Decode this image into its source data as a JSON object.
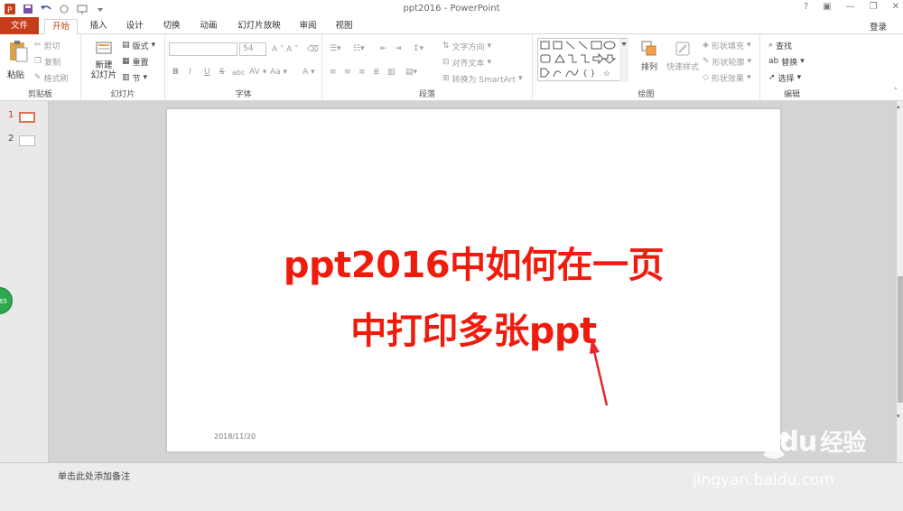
{
  "window": {
    "title": "ppt2016 - PowerPoint",
    "controls": [
      "?",
      "▣",
      "—",
      "❐",
      "✕"
    ]
  },
  "quick_access": [
    "ppt-icon",
    "save-icon",
    "undo-icon",
    "redo-icon",
    "present-icon",
    "customize-icon"
  ],
  "tabs": [
    {
      "label": "文件"
    },
    {
      "label": "开始"
    },
    {
      "label": "插入"
    },
    {
      "label": "设计"
    },
    {
      "label": "切换"
    },
    {
      "label": "动画"
    },
    {
      "label": "幻灯片放映"
    },
    {
      "label": "审阅"
    },
    {
      "label": "视图"
    }
  ],
  "account": {
    "login": "登录"
  },
  "ribbon": {
    "clipboard": {
      "label": "剪贴板",
      "paste": "粘贴",
      "cut": "剪切",
      "copy": "复制",
      "format_painter": "格式刷"
    },
    "slides": {
      "label": "幻灯片",
      "new_slide_1": "新建",
      "new_slide_2": "幻灯片",
      "layout": "版式",
      "reset": "重置",
      "section": "节"
    },
    "font": {
      "label": "字体",
      "font_name": "",
      "font_size": "54",
      "bold": "B",
      "italic": "I",
      "underline": "U",
      "strike": "S",
      "shadow": "abc",
      "spacing": "AV",
      "case": "Aa",
      "color": "A",
      "grow": "A",
      "shrink": "A"
    },
    "paragraph": {
      "label": "段落",
      "text_direction": "文字方向",
      "align_text": "对齐文本",
      "smartart": "转换为 SmartArt"
    },
    "drawing": {
      "label": "绘图",
      "arrange": "排列",
      "quick_styles": "快速样式",
      "shape_fill": "形状填充",
      "shape_outline": "形状轮廓",
      "shape_effects": "形状效果"
    },
    "editing": {
      "label": "编辑",
      "find": "查找",
      "replace": "替换",
      "select": "选择"
    }
  },
  "thumbnails": [
    {
      "number": "1"
    },
    {
      "number": "2"
    }
  ],
  "side_badge": "65",
  "slide": {
    "line1": "ppt2016中如何在一页",
    "line2": "中打印多张ppt",
    "date": "2018/11/20"
  },
  "notes": {
    "placeholder": "单击此处添加备注"
  },
  "watermark": {
    "logo": "Bai",
    "logo2": "du",
    "logo_cn": "经验",
    "url": "jingyan.baidu.com"
  },
  "colors": {
    "accent": "#c43e1c",
    "headline": "#ef1c0e",
    "arrow": "#e8252b"
  }
}
